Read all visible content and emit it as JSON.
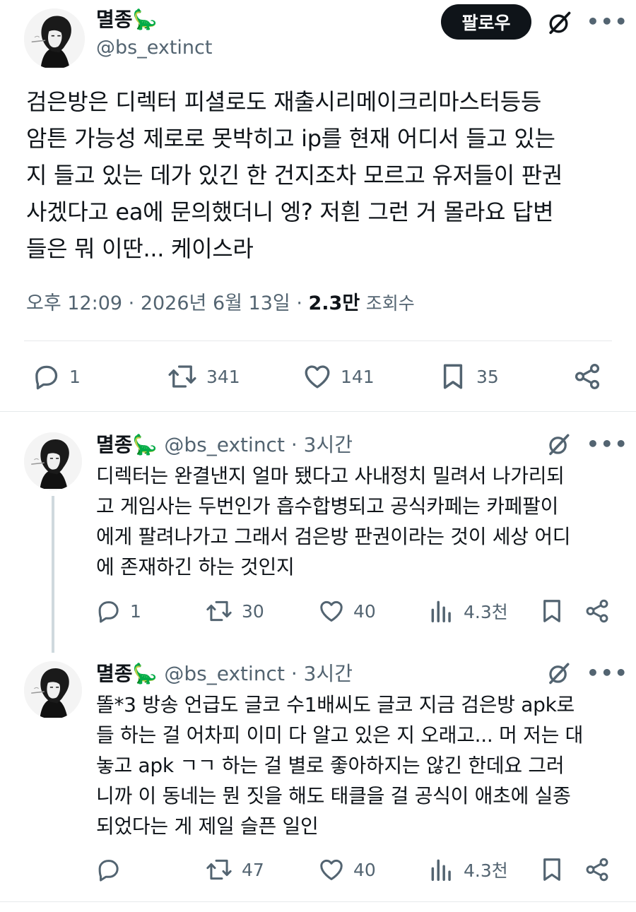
{
  "tweet": {
    "author_name": "멸종🦕",
    "author_handle": "@bs_extinct",
    "follow_label": "팔로우",
    "body_lines": [
      "검은방은 디렉터 피셜로도 재출시리메이크리마스터등등",
      "암튼 가능성 제로로 못박히고 ip를 현재 어디서 들고 있는",
      "지 들고 있는 데가 있긴 한 건지조차 모르고 유저들이 판권",
      "사겠다고 ea에 문의했더니 엥? 저흰 그런 거 몰라요 답변",
      "들은 뭐 이딴... 케이스라"
    ],
    "timestamp": "오후 12:09 · 2026년 6월 13일 ·",
    "views_count": "2.3만",
    "views_label": "조회수",
    "replies": "1",
    "retweets": "341",
    "likes": "141",
    "bookmarks": "35"
  },
  "replies": [
    {
      "author_name": "멸종🦕",
      "handle_time": "@bs_extinct · 3시간",
      "body_lines": [
        "디렉터는 완결낸지 얼마 됐다고 사내정치 밀려서 나가리되",
        "고 게임사는 두번인가 흡수합병되고 공식카페는 카페팔이",
        "에게 팔려나가고 그래서 검은방 판권이라는 것이 세상 어디",
        "에 존재하긴 하는 것인지"
      ],
      "replies": "1",
      "retweets": "30",
      "likes": "40",
      "views": "4.3천"
    },
    {
      "author_name": "멸종🦕",
      "handle_time": "@bs_extinct · 3시간",
      "body_lines": [
        "똘*3 방송 언급도 글코 수1배씨도 글코 지금 검은방 apk로",
        "들 하는 걸 어차피 이미 다 알고 있은 지 오래고... 머 저는 대",
        "놓고 apk ㄱㄱ 하는 걸 별로 좋아하지는 않긴 한데요 그러",
        "니까 이 동네는 뭔 짓을 해도 태클을 걸 공식이 애초에 실종",
        "되었다는 게 제일 슬픈 일인"
      ],
      "replies": "",
      "retweets": "47",
      "likes": "40",
      "views": "4.3천"
    }
  ],
  "icons": {
    "grok": "grok-slash-circle-icon",
    "more": "more-dots-icon",
    "reply": "reply-bubble-icon",
    "retweet": "retweet-icon",
    "like": "heart-icon",
    "bookmark": "bookmark-icon",
    "share": "share-icon",
    "views": "views-bars-icon"
  },
  "colors": {
    "text": "#0f1419",
    "secondary": "#536471",
    "follow_bg": "#0f1419",
    "divider": "#e6e9eb",
    "thread_line": "#cfd9de"
  }
}
